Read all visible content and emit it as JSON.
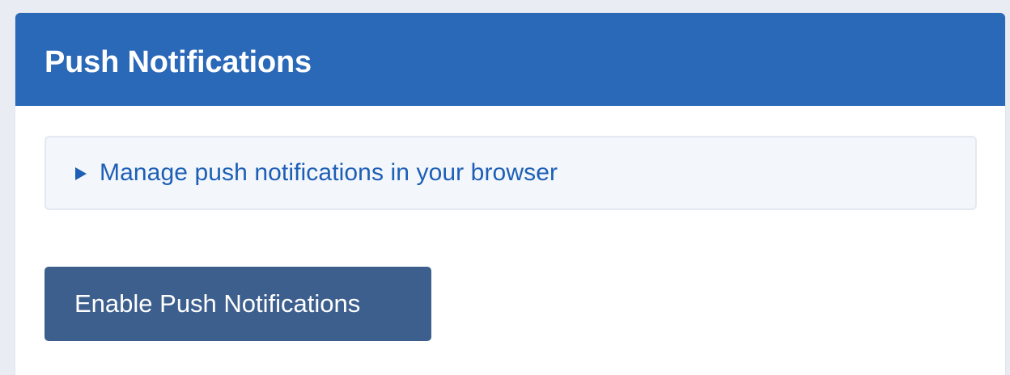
{
  "header": {
    "title": "Push Notifications"
  },
  "details": {
    "summary": "Manage push notifications in your browser",
    "icon": "disclosure-triangle-right-icon"
  },
  "actions": {
    "enable_label": "Enable Push Notifications"
  },
  "colors": {
    "header_bg": "#2a68b8",
    "link_text": "#1d5fb6",
    "button_bg": "#3d5f8d"
  }
}
